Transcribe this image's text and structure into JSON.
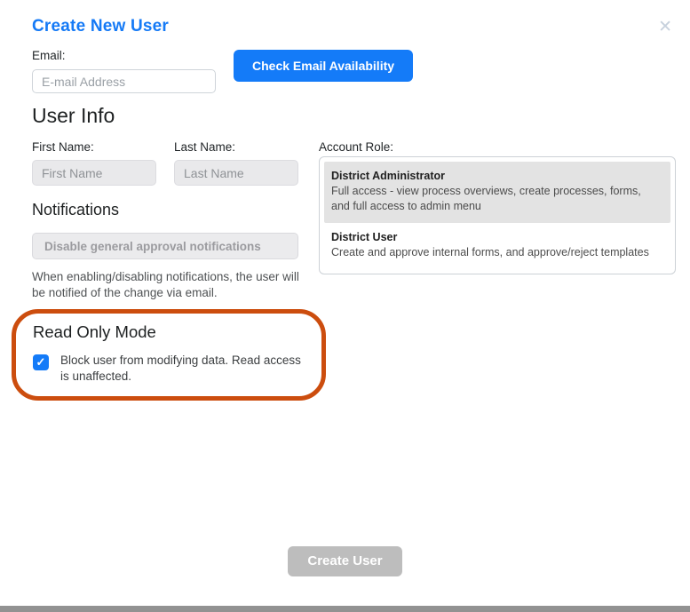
{
  "dialog": {
    "title": "Create New User"
  },
  "icons": {
    "close": "✕",
    "check": "✓"
  },
  "email_section": {
    "label": "Email:",
    "placeholder": "E-mail Address",
    "check_button": "Check Email Availability"
  },
  "user_info": {
    "heading": "User Info",
    "first_name": {
      "label": "First Name:",
      "placeholder": "First Name"
    },
    "last_name": {
      "label": "Last Name:",
      "placeholder": "Last Name"
    },
    "account_role": {
      "label": "Account Role:",
      "options": [
        {
          "name": "District Administrator",
          "description": "Full access - view process overviews, create processes, forms, and full access to admin menu",
          "selected": true
        },
        {
          "name": "District User",
          "description": "Create and approve internal forms, and approve/reject templates",
          "selected": false
        }
      ]
    }
  },
  "notifications": {
    "heading": "Notifications",
    "toggle_button": "Disable general approval notifications",
    "help_text": "When enabling/disabling notifications, the user will be notified of the change via email."
  },
  "read_only_mode": {
    "heading": "Read Only Mode",
    "checkbox_checked": true,
    "description": "Block user from modifying data. Read access is unaffected."
  },
  "footer": {
    "create_button": "Create User"
  },
  "colors": {
    "accent_blue": "#147bf8",
    "annotation_orange": "#cc4d0e",
    "disabled_gray": "#bdbdbd",
    "selected_option_gray": "#e3e3e3"
  }
}
